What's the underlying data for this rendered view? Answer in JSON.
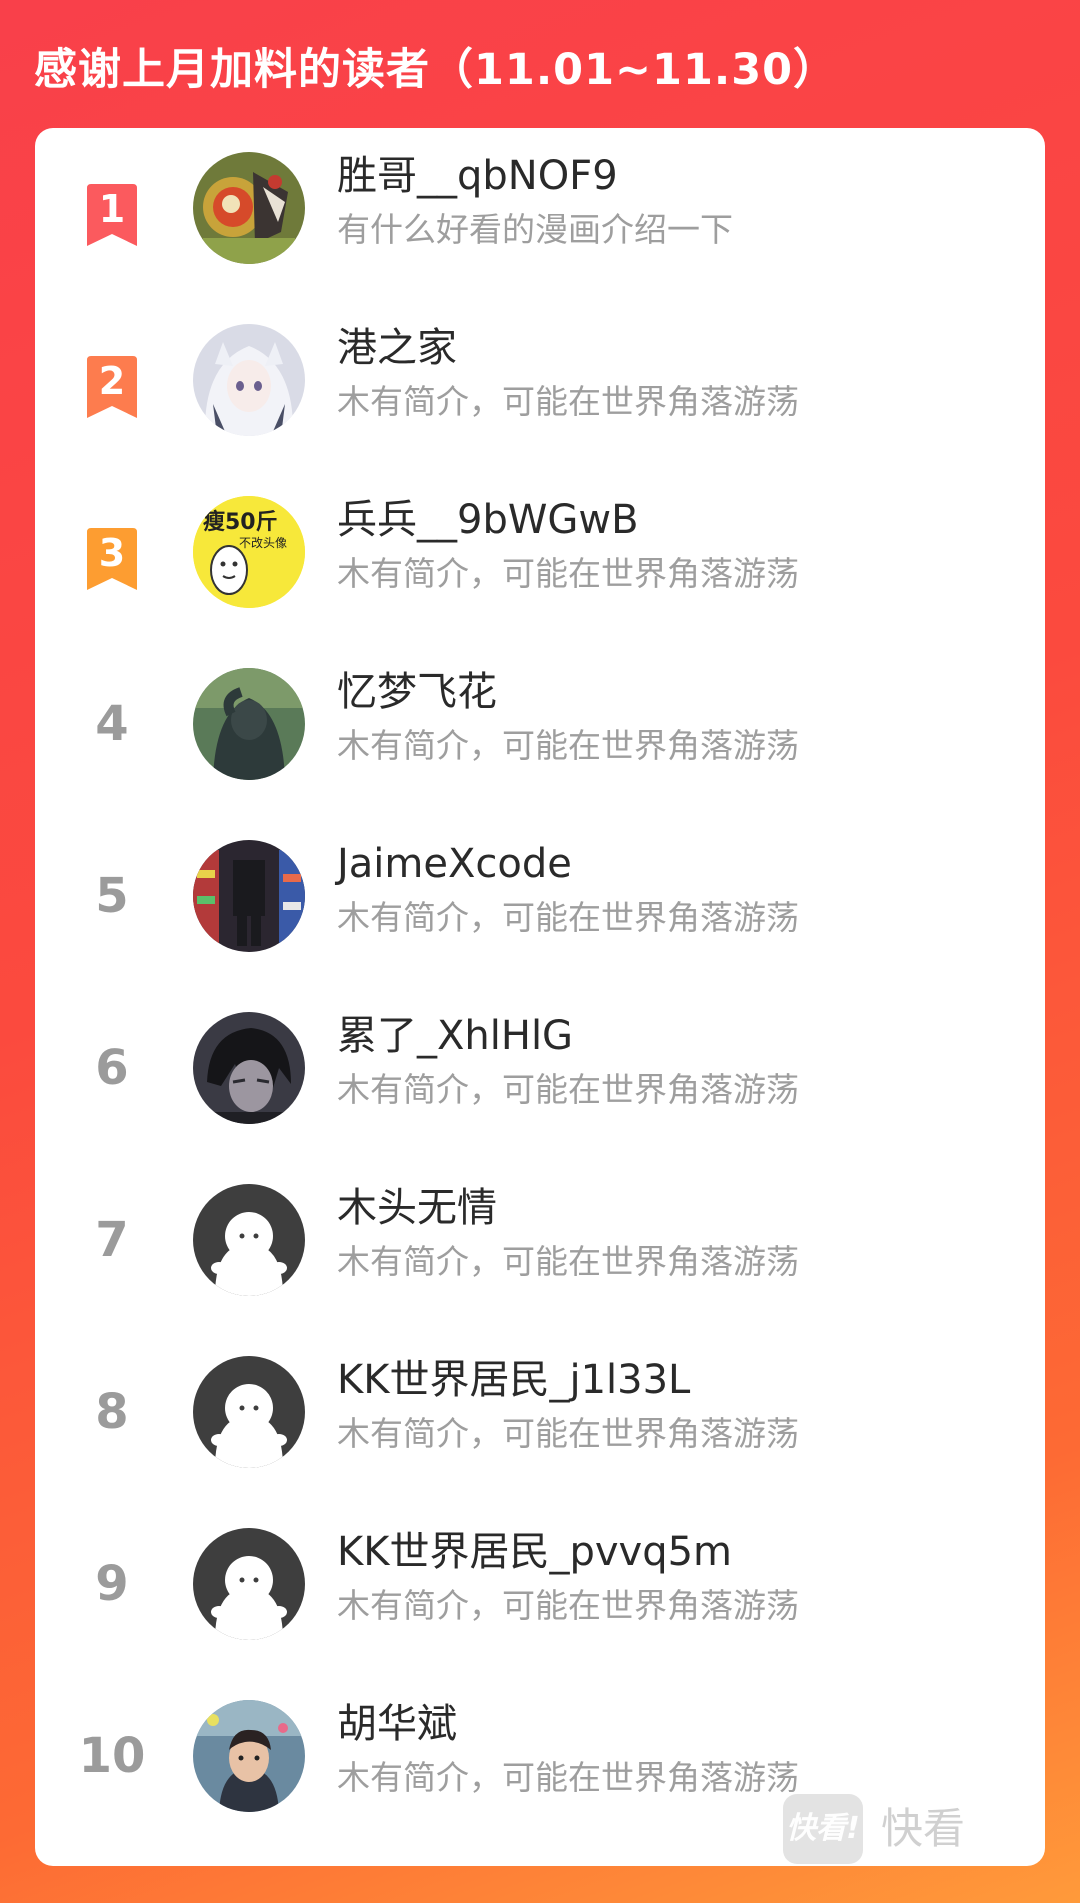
{
  "header": {
    "title": "感谢上月加料的读者（11.01~11.30）"
  },
  "colors": {
    "rank1": "#fb5a5e",
    "rank2": "#fd7c4e",
    "rank3": "#fd9d31",
    "rank_plain": "#9b9b9b",
    "name_text": "#2a2a2a",
    "bio_text": "#9e9e9e"
  },
  "readers": [
    {
      "rank": "1",
      "name": "胜哥__qbNOF9",
      "bio": "有什么好看的漫画介绍一下"
    },
    {
      "rank": "2",
      "name": "港之家",
      "bio": "木有简介，可能在世界角落游荡"
    },
    {
      "rank": "3",
      "name": "兵兵__9bWGwB",
      "bio": "木有简介，可能在世界角落游荡"
    },
    {
      "rank": "4",
      "name": "忆梦飞花",
      "bio": "木有简介，可能在世界角落游荡"
    },
    {
      "rank": "5",
      "name": "JaimeXcode",
      "bio": "木有简介，可能在世界角落游荡"
    },
    {
      "rank": "6",
      "name": "累了_XhlHlG",
      "bio": "木有简介，可能在世界角落游荡"
    },
    {
      "rank": "7",
      "name": "木头无情",
      "bio": "木有简介，可能在世界角落游荡"
    },
    {
      "rank": "8",
      "name": "KK世界居民_j1l33L",
      "bio": "木有简介，可能在世界角落游荡"
    },
    {
      "rank": "9",
      "name": "KK世界居民_pvvq5m",
      "bio": "木有简介，可能在世界角落游荡"
    },
    {
      "rank": "10",
      "name": "胡华斌",
      "bio": "木有简介，可能在世界角落游荡"
    }
  ],
  "avatar_sticker": {
    "line1": "瘦50斤",
    "line2": "不改头像"
  },
  "watermark": {
    "logo": "快看!",
    "text": "快看"
  }
}
